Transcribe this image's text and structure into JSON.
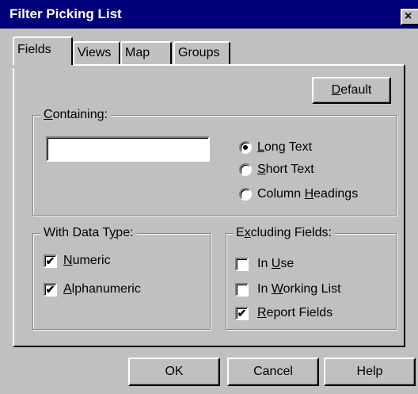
{
  "window": {
    "title": "Filter Picking List",
    "close_glyph": "×"
  },
  "tabs": [
    {
      "label": "Fields",
      "active": true
    },
    {
      "label": "Views",
      "active": false
    },
    {
      "label": "Map",
      "active": false
    },
    {
      "label": "Groups",
      "active": false
    }
  ],
  "default_button": {
    "pre": "",
    "key": "D",
    "post": "efault"
  },
  "containing": {
    "legend": {
      "pre": "",
      "key": "C",
      "post": "ontaining:"
    },
    "text_value": "",
    "options": [
      {
        "pre": "",
        "key": "L",
        "post": "ong Text",
        "selected": true
      },
      {
        "pre": "",
        "key": "S",
        "post": "hort Text",
        "selected": false
      },
      {
        "pre": "Column ",
        "key": "H",
        "post": "eadings",
        "selected": false
      }
    ]
  },
  "data_type": {
    "legend": {
      "pre": "With Data T",
      "key": "y",
      "post": "pe:"
    },
    "items": [
      {
        "pre": "",
        "key": "N",
        "post": "umeric",
        "checked": true
      },
      {
        "pre": "",
        "key": "A",
        "post": "lphanumeric",
        "checked": true
      }
    ]
  },
  "excluding": {
    "legend": {
      "pre": "E",
      "key": "x",
      "post": "cluding Fields:"
    },
    "items": [
      {
        "pre": "In ",
        "key": "U",
        "post": "se",
        "checked": false
      },
      {
        "pre": "In ",
        "key": "W",
        "post": "orking List",
        "checked": false
      },
      {
        "pre": "",
        "key": "R",
        "post": "eport Fields",
        "checked": true
      }
    ]
  },
  "footer": {
    "ok": "OK",
    "cancel": "Cancel",
    "help": "Help"
  },
  "check_glyph": "✔"
}
